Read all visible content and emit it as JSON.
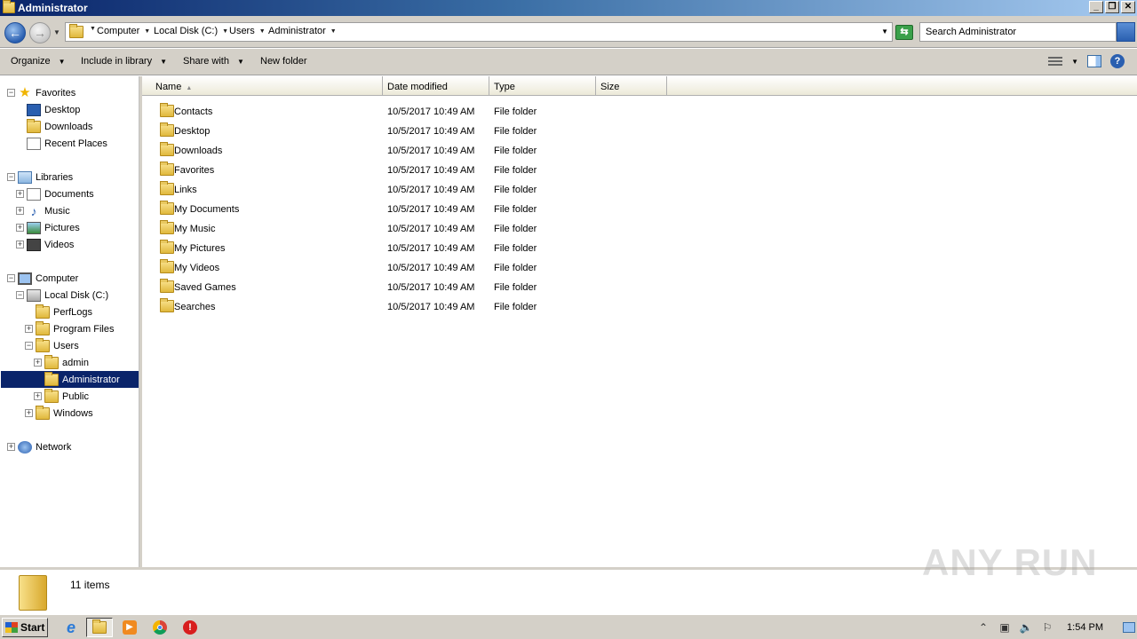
{
  "window": {
    "title": "Administrator",
    "controls": {
      "minimize": "_",
      "maximize": "❐",
      "close": "✕"
    }
  },
  "address": {
    "crumbs": [
      "Computer",
      "Local Disk (C:)",
      "Users",
      "Administrator"
    ],
    "search_placeholder": "Search Administrator"
  },
  "toolbar": {
    "organize": "Organize",
    "include_in_library": "Include in library",
    "share_with": "Share with",
    "new_folder": "New folder"
  },
  "nav": {
    "favorites": {
      "label": "Favorites",
      "items": [
        "Desktop",
        "Downloads",
        "Recent Places"
      ]
    },
    "libraries": {
      "label": "Libraries",
      "items": [
        "Documents",
        "Music",
        "Pictures",
        "Videos"
      ]
    },
    "computer": {
      "label": "Computer",
      "local_disk": "Local Disk (C:)",
      "perflogs": "PerfLogs",
      "program_files": "Program Files",
      "users": "Users",
      "admin": "admin",
      "administrator": "Administrator",
      "public": "Public",
      "windows": "Windows"
    },
    "network": "Network"
  },
  "columns": {
    "name": "Name",
    "date": "Date modified",
    "type": "Type",
    "size": "Size"
  },
  "files": [
    {
      "name": "Contacts",
      "date": "10/5/2017 10:49 AM",
      "type": "File folder"
    },
    {
      "name": "Desktop",
      "date": "10/5/2017 10:49 AM",
      "type": "File folder"
    },
    {
      "name": "Downloads",
      "date": "10/5/2017 10:49 AM",
      "type": "File folder"
    },
    {
      "name": "Favorites",
      "date": "10/5/2017 10:49 AM",
      "type": "File folder"
    },
    {
      "name": "Links",
      "date": "10/5/2017 10:49 AM",
      "type": "File folder"
    },
    {
      "name": "My Documents",
      "date": "10/5/2017 10:49 AM",
      "type": "File folder"
    },
    {
      "name": "My Music",
      "date": "10/5/2017 10:49 AM",
      "type": "File folder"
    },
    {
      "name": "My Pictures",
      "date": "10/5/2017 10:49 AM",
      "type": "File folder"
    },
    {
      "name": "My Videos",
      "date": "10/5/2017 10:49 AM",
      "type": "File folder"
    },
    {
      "name": "Saved Games",
      "date": "10/5/2017 10:49 AM",
      "type": "File folder"
    },
    {
      "name": "Searches",
      "date": "10/5/2017 10:49 AM",
      "type": "File folder"
    }
  ],
  "status": {
    "count": "11 items"
  },
  "watermark": "ANY RUN",
  "taskbar": {
    "start": "Start",
    "apps": [
      "internet-explorer-icon",
      "explorer-icon",
      "media-player-icon",
      "chrome-icon",
      "stop-icon"
    ],
    "clock": "1:54 PM"
  }
}
